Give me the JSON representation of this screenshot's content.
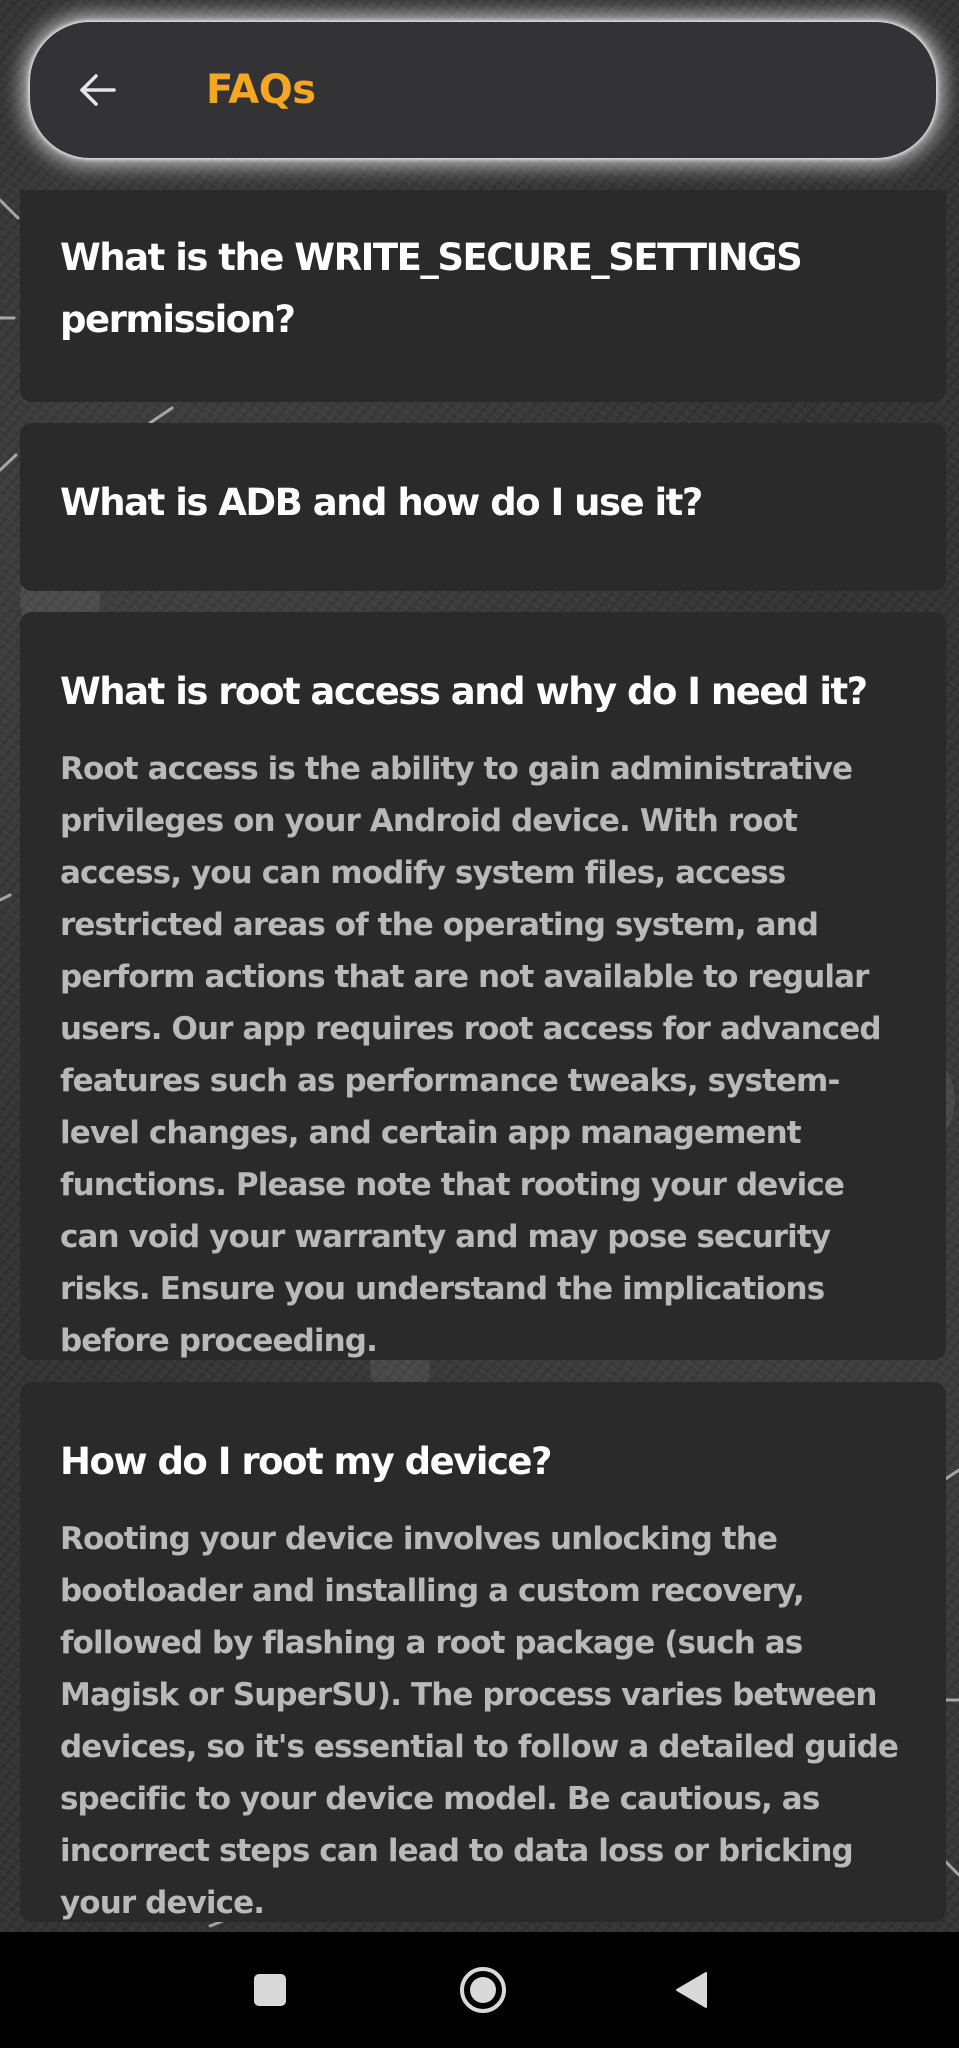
{
  "header": {
    "title": "FAQs",
    "title_color": "#f5a623",
    "back_icon": "arrow-left-icon"
  },
  "faqs": [
    {
      "question": "What is the WRITE_SECURE_SETTINGS permission?",
      "expanded": false
    },
    {
      "question": "What is ADB and how do I use it?",
      "expanded": false
    },
    {
      "question": "What is root access and why do I need it?",
      "answer": "Root access is the ability to gain administrative privileges on your Android device. With root access, you can modify system files, access restricted areas of the operating system, and perform actions that are not available to regular users. Our app requires root access for advanced features such as performance tweaks, system-level changes, and certain app management functions. Please note that rooting your device can void your warranty and may pose security risks. Ensure you understand the implications before proceeding.",
      "expanded": true
    },
    {
      "question": "How do I root my device?",
      "answer": "Rooting your device involves unlocking the bootloader and installing a custom recovery, followed by flashing a root package (such as Magisk or SuperSU). The process varies between devices, so it's essential to follow a detailed guide specific to your device model. Be cautious, as incorrect steps can lead to data loss or bricking your device.",
      "expanded": true
    }
  ],
  "system_nav": {
    "recents_icon": "square-recents-icon",
    "home_icon": "circle-home-icon",
    "back_icon": "triangle-back-icon"
  },
  "colors": {
    "card_background": "#2a2a2b",
    "question_text": "#ffffff",
    "answer_text": "#b9b9b9"
  }
}
